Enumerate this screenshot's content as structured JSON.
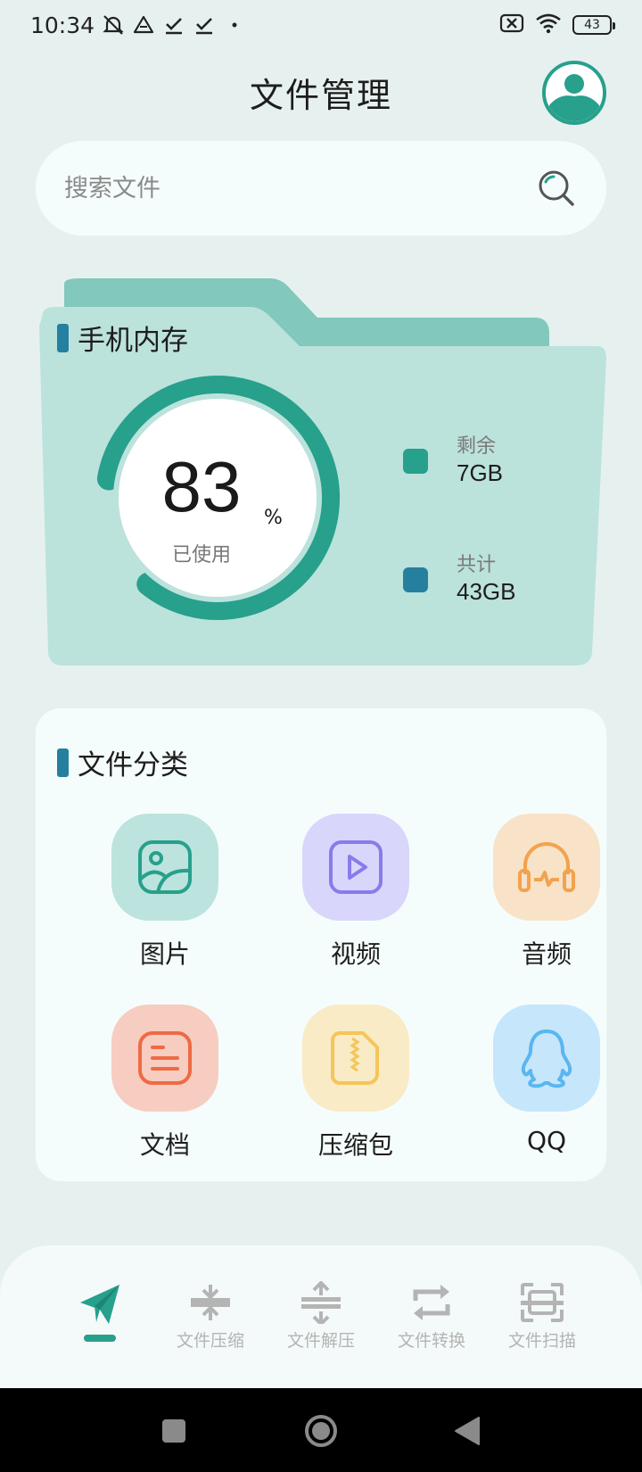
{
  "status_bar": {
    "time": "10:34",
    "battery": "43",
    "icons": [
      "mute-vibrate-icon",
      "drive-icon",
      "download-done-icon",
      "download-done-icon",
      "dot-icon",
      "sim-off-icon",
      "wifi-icon",
      "battery-icon"
    ]
  },
  "header": {
    "title": "文件管理",
    "avatar_icon": "user-avatar-icon"
  },
  "search": {
    "placeholder": "搜索文件",
    "value": "",
    "icon": "search-icon"
  },
  "storage": {
    "title": "手机内存",
    "used_percent_value": "83",
    "percent_sign": "%",
    "used_label": "已使用",
    "used_fraction": 0.83,
    "remaining_label": "剩余",
    "remaining_value": "7GB",
    "total_label": "共计",
    "total_value": "43GB",
    "colors": {
      "ring": "#27A08C",
      "remaining_swatch": "#27A08C",
      "total_swatch": "#2580A0",
      "folder_back": "#82C8BC",
      "folder_front": "#BCE2DC"
    }
  },
  "categories": {
    "title": "文件分类",
    "items": [
      {
        "label": "图片",
        "icon": "image-icon",
        "bg": "#BCE3DD",
        "fg": "#27A08C"
      },
      {
        "label": "视频",
        "icon": "video-play-icon",
        "bg": "#D9D6FB",
        "fg": "#8A7BEA"
      },
      {
        "label": "音频",
        "icon": "headphones-icon",
        "bg": "#F8E3C8",
        "fg": "#F3A24E"
      },
      {
        "label": "文档",
        "icon": "document-icon",
        "bg": "#F6CDC0",
        "fg": "#EE6A45"
      },
      {
        "label": "压缩包",
        "icon": "zip-file-icon",
        "bg": "#F9EBC5",
        "fg": "#F4C55A"
      },
      {
        "label": "QQ",
        "icon": "qq-penguin-icon",
        "bg": "#C6E6FB",
        "fg": "#5AB6F0"
      }
    ]
  },
  "bottom_nav": {
    "items": [
      {
        "label": "",
        "icon": "paper-plane-icon",
        "active": true
      },
      {
        "label": "文件压缩",
        "icon": "compress-icon",
        "active": false
      },
      {
        "label": "文件解压",
        "icon": "decompress-icon",
        "active": false
      },
      {
        "label": "文件转换",
        "icon": "convert-icon",
        "active": false
      },
      {
        "label": "文件扫描",
        "icon": "scan-icon",
        "active": false
      }
    ],
    "colors": {
      "active": "#27A08C",
      "inactive": "#B4B4B4"
    }
  },
  "system_nav": {
    "icons": [
      "recents-square-icon",
      "home-circle-icon",
      "back-triangle-icon"
    ]
  }
}
